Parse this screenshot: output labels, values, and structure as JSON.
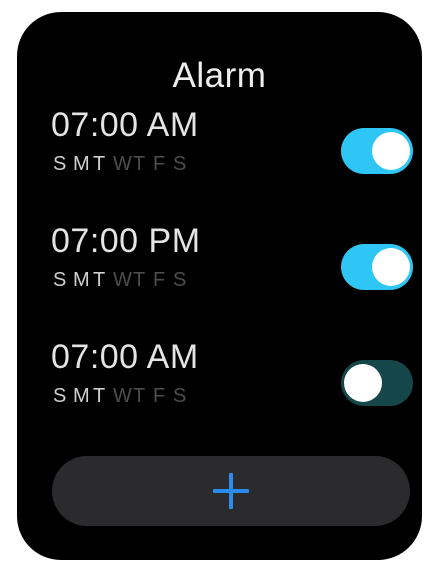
{
  "title": "Alarm",
  "accent_color": "#2ec6f5",
  "alarms": [
    {
      "time": "07:00 AM",
      "enabled": true,
      "days": [
        {
          "letter": "S",
          "active": true
        },
        {
          "letter": "M",
          "active": true
        },
        {
          "letter": "T",
          "active": true
        },
        {
          "letter": "W",
          "active": false
        },
        {
          "letter": "T",
          "active": false
        },
        {
          "letter": "F",
          "active": false
        },
        {
          "letter": "S",
          "active": false
        }
      ]
    },
    {
      "time": "07:00 PM",
      "enabled": true,
      "days": [
        {
          "letter": "S",
          "active": true
        },
        {
          "letter": "M",
          "active": true
        },
        {
          "letter": "T",
          "active": true
        },
        {
          "letter": "W",
          "active": false
        },
        {
          "letter": "T",
          "active": false
        },
        {
          "letter": "F",
          "active": false
        },
        {
          "letter": "S",
          "active": false
        }
      ]
    },
    {
      "time": "07:00 AM",
      "enabled": false,
      "days": [
        {
          "letter": "S",
          "active": true
        },
        {
          "letter": "M",
          "active": true
        },
        {
          "letter": "T",
          "active": true
        },
        {
          "letter": "W",
          "active": false
        },
        {
          "letter": "T",
          "active": false
        },
        {
          "letter": "F",
          "active": false
        },
        {
          "letter": "S",
          "active": false
        }
      ]
    }
  ],
  "add_button": {
    "icon": "plus-icon"
  }
}
